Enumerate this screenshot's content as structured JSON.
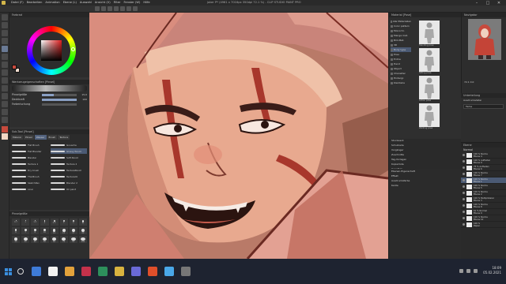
{
  "window": {
    "menu_items": [
      "Datei (F)",
      "Bearbeiten",
      "Animation",
      "Ebene (L)",
      "Auswahl",
      "Ansicht (V)",
      "Filter",
      "Fenster (W)",
      "Hilfe"
    ],
    "doc_title": "joker P* (4961 x 7016px 350dpi 72.1 %) - CLIP STUDIO PAINT PRO",
    "minimize": "–",
    "maximize": "□",
    "close": "✕"
  },
  "color_panel": {
    "title": "Farbrad",
    "main_color": "#c74a3d",
    "sub_color": "#f4ddd0"
  },
  "brush_settings": {
    "title": "Werkzeugeigenschaften [Pinsel]",
    "rows": [
      {
        "label": "Pinselgröße",
        "value": "15,0",
        "fill_fraction": 0.35
      },
      {
        "label": "Deckkraft",
        "value": "100",
        "fill_fraction": 1.0
      },
      {
        "label": "Farbmischung",
        "value": "",
        "fill_fraction": 0.0
      }
    ]
  },
  "subtool": {
    "title": "Sub-Tool [Pinsel]",
    "tabs": [
      "Malerei",
      "Pinsel",
      "Wasser",
      "Brush",
      "Texture"
    ],
    "active_tab": 2,
    "brushes": [
      {
        "name": "Flat Brush"
      },
      {
        "name": "Gouache"
      },
      {
        "name": "Flat Blender"
      },
      {
        "name": "Glossy Pencil"
      },
      {
        "name": "Blender"
      },
      {
        "name": "Soft Pencil"
      },
      {
        "name": "Texture 1"
      },
      {
        "name": "Texture 2"
      },
      {
        "name": "Dry brush"
      },
      {
        "name": "TexturePencil"
      },
      {
        "name": "ThinBrush"
      },
      {
        "name": "TextureOil"
      },
      {
        "name": "SketchPen"
      },
      {
        "name": "Blender 2"
      },
      {
        "name": "Liner"
      },
      {
        "name": "Oil paint"
      }
    ],
    "selected_index": 3
  },
  "brush_sizes": {
    "title": "Pinselgröße",
    "values": [
      "0.7",
      "1",
      "1.5",
      "2",
      "2.5",
      "3",
      "4",
      "5",
      "6",
      "7",
      "8",
      "10",
      "12",
      "15",
      "17",
      "20",
      "25",
      "30",
      "40",
      "50",
      "60",
      "70",
      "80",
      "100"
    ]
  },
  "material": {
    "title": "Material [Pose]",
    "tree": [
      "Alle Materialien",
      "Color pattern",
      "Monochr.",
      "Manga mat.",
      "Bild-Mat.",
      "3D",
      "Body type",
      "Pose",
      "Entire",
      "Hand",
      "Object",
      "Charakter",
      "Hintergr.",
      "Kleinteile"
    ],
    "selected_node": 6,
    "thumbs": [
      "Standing pose",
      "Sitting pose",
      "Action pose",
      "Walking pose"
    ],
    "bottom_items": [
      "Stockwerk",
      "Schublade",
      "Vorgänger",
      "Zuschnitte",
      "Tag-Vorlagen",
      "Kopierliste",
      "User-Tags",
      "Birds_type"
    ]
  },
  "navigator": {
    "title": "Navigator",
    "zoom": "72.1",
    "rotation": "0.0"
  },
  "sub_view": {
    "title": "Unterteilung",
    "label": "Ausdrucksdatei",
    "dropdown": "Farbe"
  },
  "layers": {
    "title": "Ebene",
    "blend": "Normal",
    "items": [
      {
        "name": "100 % Normal\nEbene 4"
      },
      {
        "name": "100 % Aufhellen\nEbene 9"
      },
      {
        "name": "75 % Aufhellen\nEbene 6"
      },
      {
        "name": "100 % Normal\nEbene 7"
      },
      {
        "name": "100 % Normal\nEbene 1"
      },
      {
        "name": "100 % Normal\nEbene 5"
      },
      {
        "name": "100 % Normal\nEbene 2"
      },
      {
        "name": "100 % Multiplizieren\nEbene 3"
      },
      {
        "name": "100 % Normal\nEbene 8"
      },
      {
        "name": "61 % Normal\nEbene 0"
      },
      {
        "name": "100 % Normal\nEbene 10"
      },
      {
        "name": "100 %\nPapier"
      }
    ],
    "selected_index": 4
  },
  "layer_extra": {
    "rows": [
      "Ebenen-Eigenschaft",
      "Effekt",
      "Ausdrucksfarbe",
      "Kante"
    ]
  },
  "taskbar": {
    "time": "18:09",
    "date": "05.02.2021",
    "app_colors": [
      "#3e7bd8",
      "#f2f2f2",
      "#e2a13b",
      "#c4314b",
      "#2d8f5c",
      "#d8b33f",
      "#6a6ad8",
      "#e04f2a",
      "#4aa8e8",
      "#777777"
    ]
  }
}
